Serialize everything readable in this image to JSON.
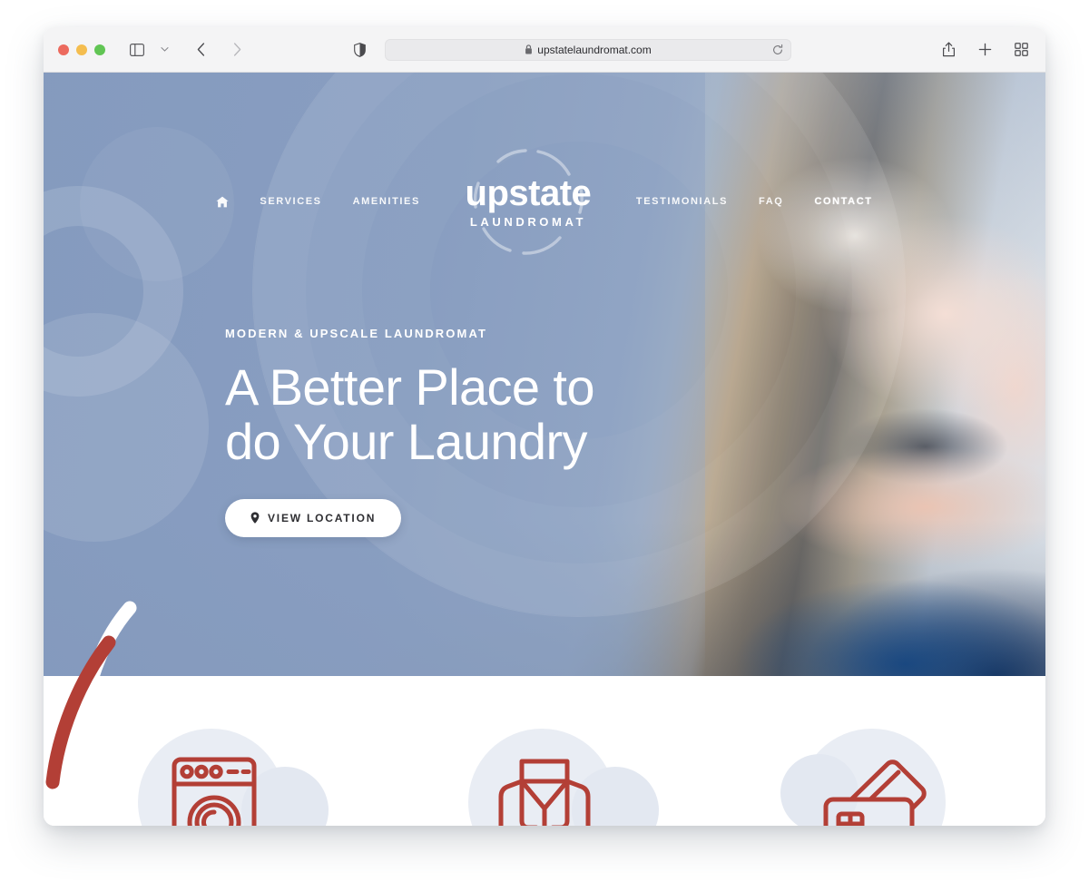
{
  "browser": {
    "traffic_lights": [
      "close",
      "minimize",
      "zoom"
    ],
    "sidebar_label": "Sidebar",
    "tab_overview_label": "Tab Overview",
    "back_label": "Back",
    "forward_label": "Forward",
    "shield_label": "Privacy Report",
    "url": "upstatelaundromat.com",
    "reload_label": "Reload",
    "share_label": "Share",
    "new_tab_label": "New Tab",
    "tab_grid_label": "Show Tab Overview"
  },
  "site": {
    "logo": {
      "word": "upstate",
      "sub": "LAUNDROMAT"
    },
    "nav_left": [
      {
        "label": "",
        "name": "home",
        "icon": "home-icon",
        "active": false
      },
      {
        "label": "SERVICES",
        "name": "services",
        "active": false
      },
      {
        "label": "AMENITIES",
        "name": "amenities",
        "active": false
      }
    ],
    "nav_right": [
      {
        "label": "TESTIMONIALS",
        "name": "testimonials",
        "active": false
      },
      {
        "label": "FAQ",
        "name": "faq",
        "active": false
      },
      {
        "label": "CONTACT",
        "name": "contact",
        "active": true
      }
    ],
    "hero": {
      "eyebrow": "MODERN & UPSCALE LAUNDROMAT",
      "headline": "A Better Place to\ndo Your Laundry",
      "cta_label": "VIEW LOCATION",
      "cta_icon": "location-pin-icon"
    },
    "services": [
      {
        "icon": "washing-machine-icon",
        "name": "service-wash"
      },
      {
        "icon": "folded-shirt-icon",
        "name": "service-fold"
      },
      {
        "icon": "credit-cards-icon",
        "name": "service-payment"
      }
    ],
    "colors": {
      "brand_red": "#b33f36",
      "hero_blue": "#8fa5c6",
      "blob_blue": "#e9edf4",
      "white": "#ffffff"
    }
  }
}
